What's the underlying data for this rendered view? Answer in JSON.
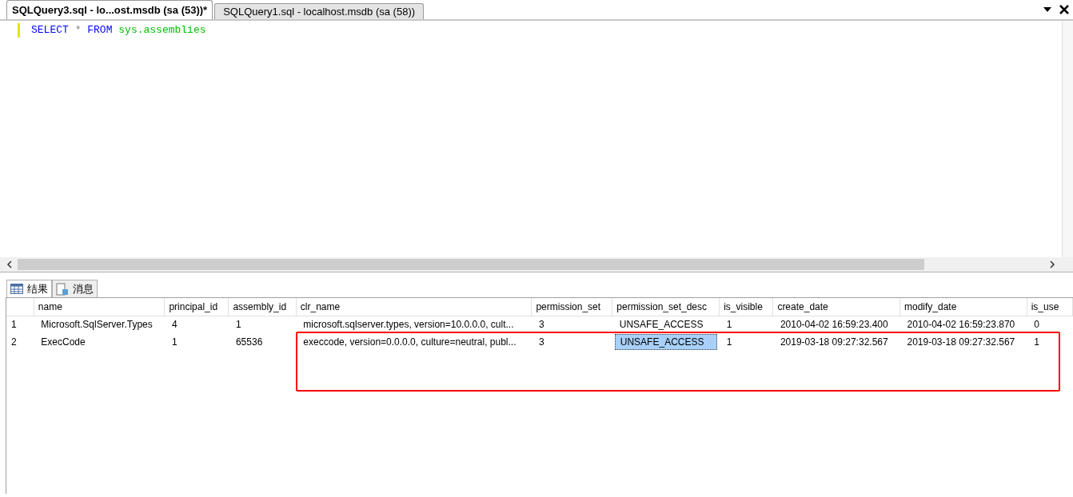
{
  "doc_tabs": [
    {
      "label": "SQLQuery3.sql - lo...ost.msdb (sa (53))*",
      "selected": true
    },
    {
      "label": "SQLQuery1.sql - localhost.msdb (sa (58))",
      "selected": false
    }
  ],
  "editor": {
    "tokens": [
      {
        "text": "SELECT",
        "kind": "keyword"
      },
      {
        "text": "*",
        "kind": "operator"
      },
      {
        "text": "FROM",
        "kind": "keyword"
      },
      {
        "text": "sys.assemblies",
        "kind": "object"
      }
    ]
  },
  "result_tabs": [
    {
      "label": "结果",
      "kind": "grid",
      "selected": true
    },
    {
      "label": "消息",
      "kind": "messages",
      "selected": false
    }
  ],
  "grid": {
    "columns": [
      "name",
      "principal_id",
      "assembly_id",
      "clr_name",
      "permission_set",
      "permission_set_desc",
      "is_visible",
      "create_date",
      "modify_date",
      "is_use"
    ],
    "rows": [
      {
        "number": "1",
        "cells": [
          {
            "value": "Microsoft.SqlServer.Types",
            "selected": false
          },
          {
            "value": "4",
            "selected": false
          },
          {
            "value": "1",
            "selected": false
          },
          {
            "value": "microsoft.sqlserver.types, version=10.0.0.0, cult...",
            "selected": false
          },
          {
            "value": "3",
            "selected": false
          },
          {
            "value": "UNSAFE_ACCESS",
            "selected": false
          },
          {
            "value": "1",
            "selected": false
          },
          {
            "value": "2010-04-02 16:59:23.400",
            "selected": false
          },
          {
            "value": "2010-04-02 16:59:23.870",
            "selected": false
          },
          {
            "value": "0",
            "selected": false
          }
        ]
      },
      {
        "number": "2",
        "cells": [
          {
            "value": "ExecCode",
            "selected": false
          },
          {
            "value": "1",
            "selected": false
          },
          {
            "value": "65536",
            "selected": false
          },
          {
            "value": "execcode, version=0.0.0.0, culture=neutral, publ...",
            "selected": false
          },
          {
            "value": "3",
            "selected": false
          },
          {
            "value": "UNSAFE_ACCESS",
            "selected": true
          },
          {
            "value": "1",
            "selected": false
          },
          {
            "value": "2019-03-18 09:27:32.567",
            "selected": false
          },
          {
            "value": "2019-03-18 09:27:32.567",
            "selected": false
          },
          {
            "value": "1",
            "selected": false
          }
        ]
      }
    ]
  },
  "highlight": {
    "shown": true
  }
}
